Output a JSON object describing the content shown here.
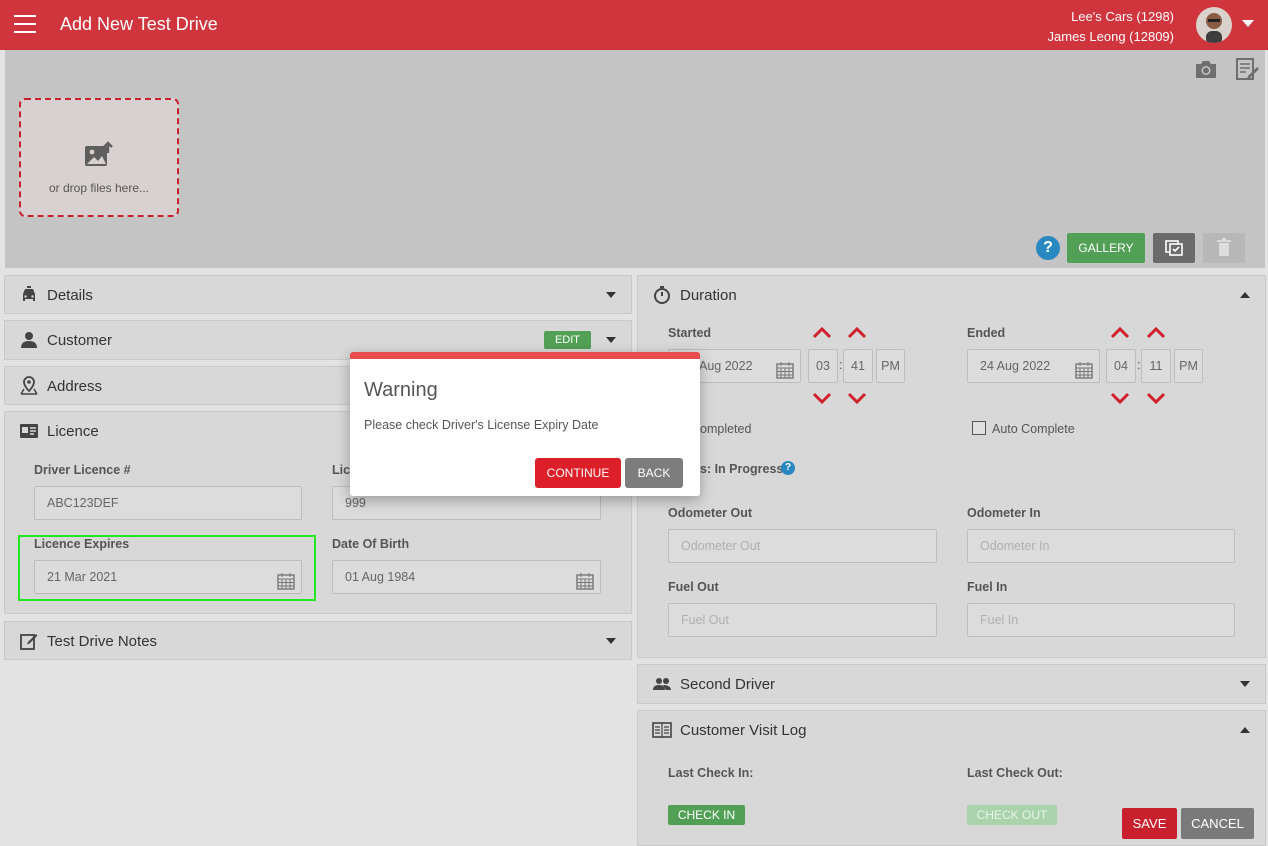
{
  "header": {
    "title": "Add New Test Drive",
    "dealer": "Lee's Cars (1298)",
    "user": "James Leong (12809)"
  },
  "upload": {
    "drop_text": "or drop files here...",
    "gallery_label": "GALLERY",
    "help_label": "?"
  },
  "sections": {
    "details": "Details",
    "customer": "Customer",
    "customer_edit": "EDIT",
    "address": "Address",
    "licence": "Licence",
    "notes": "Test Drive Notes",
    "duration": "Duration",
    "second_driver": "Second Driver",
    "visit_log": "Customer Visit Log"
  },
  "licence": {
    "number_label": "Driver Licence #",
    "number_value": "ABC123DEF",
    "second_label": "Lic",
    "second_value": "999",
    "expires_label": "Licence Expires",
    "expires_value": "21 Mar 2021",
    "dob_label": "Date Of Birth",
    "dob_value": "01 Aug 1984"
  },
  "duration": {
    "started_label": "Started",
    "started_date": "Aug 2022",
    "started_hour": "03",
    "started_min": "41",
    "started_ampm": "PM",
    "ended_label": "Ended",
    "ended_date": "24 Aug 2022",
    "ended_hour": "04",
    "ended_min": "11",
    "ended_ampm": "PM",
    "completed_text": "ompleted",
    "auto_complete": "Auto Complete",
    "status_text": "s: In Progress",
    "time_sep": ":",
    "odometer_out_label": "Odometer Out",
    "odometer_out_placeholder": "Odometer Out",
    "odometer_in_label": "Odometer In",
    "odometer_in_placeholder": "Odometer In",
    "fuel_out_label": "Fuel Out",
    "fuel_out_placeholder": "Fuel Out",
    "fuel_in_label": "Fuel In",
    "fuel_in_placeholder": "Fuel In"
  },
  "visit_log": {
    "last_check_in": "Last Check In:",
    "last_check_out": "Last Check Out:",
    "check_in_btn": "CHECK IN",
    "check_out_btn": "CHECK OUT"
  },
  "actions": {
    "save": "SAVE",
    "cancel": "CANCEL"
  },
  "modal": {
    "title": "Warning",
    "message": "Please check Driver's License Expiry Date",
    "continue": "CONTINUE",
    "back": "BACK"
  }
}
